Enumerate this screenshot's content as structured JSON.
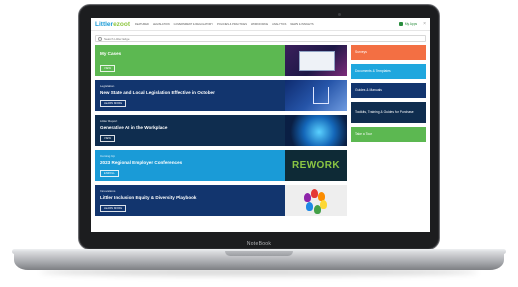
{
  "device": {
    "label": "NoteBook"
  },
  "header": {
    "logo_main": "Littler",
    "logo_accent": "ezoot",
    "nav_items": [
      "Featured",
      "Legislation",
      "Government & Regulatory",
      "Policies & Practices",
      "Workforce",
      "Analytics",
      "News & Insights"
    ],
    "account_label": "My Apps",
    "close_glyph": "×"
  },
  "search": {
    "placeholder": "Search Littler Edge"
  },
  "cards": [
    {
      "kicker": "",
      "title": "My Cases",
      "button": "View"
    },
    {
      "kicker": "Legislation",
      "title": "New State and Local Legislation Effective in October",
      "button": "Learn More"
    },
    {
      "kicker": "Littler Report",
      "title": "Generative AI in the Workplace",
      "button": "View"
    },
    {
      "kicker": "Coming Up",
      "title": "2023 Regional Employer Conferences",
      "button": "Enroll"
    },
    {
      "kicker": "Innovations",
      "title": "Littler Inclusion Equity & Diversity Playbook",
      "button": "Learn More"
    }
  ],
  "card_images": {
    "rework_text": "REWORK"
  },
  "sidebar": {
    "tiles": [
      "Surveys",
      "Documents & Templates",
      "Guides & Manuals",
      "Toolkits, Training & Guides for Purchase",
      "Take a Tour"
    ]
  },
  "colors": {
    "green": "#5cb851",
    "navy": "#12356e",
    "dark_navy": "#0f2d4f",
    "blue": "#1a9bd7",
    "orange": "#f36f43"
  }
}
